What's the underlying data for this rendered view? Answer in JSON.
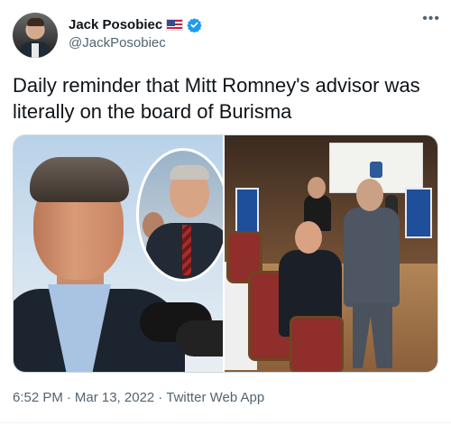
{
  "author": {
    "display_name": "Jack Posobiec",
    "handle": "@JackPosobiec",
    "flag_icon": "us-flag-icon",
    "verified_icon": "verified-badge-icon",
    "verified_color": "#1d9bf0"
  },
  "tweet": {
    "text": "Daily reminder that Mitt Romney's advisor was literally on the board of Burisma",
    "more_icon": "more-options-icon"
  },
  "meta": {
    "time": "6:52 PM",
    "dot1": "·",
    "date": "Mar 13, 2022",
    "dot2": "·",
    "source": "Twitter Web App"
  },
  "colors": {
    "text_primary": "#0f1419",
    "text_secondary": "#536471",
    "border": "#cfd9de"
  }
}
